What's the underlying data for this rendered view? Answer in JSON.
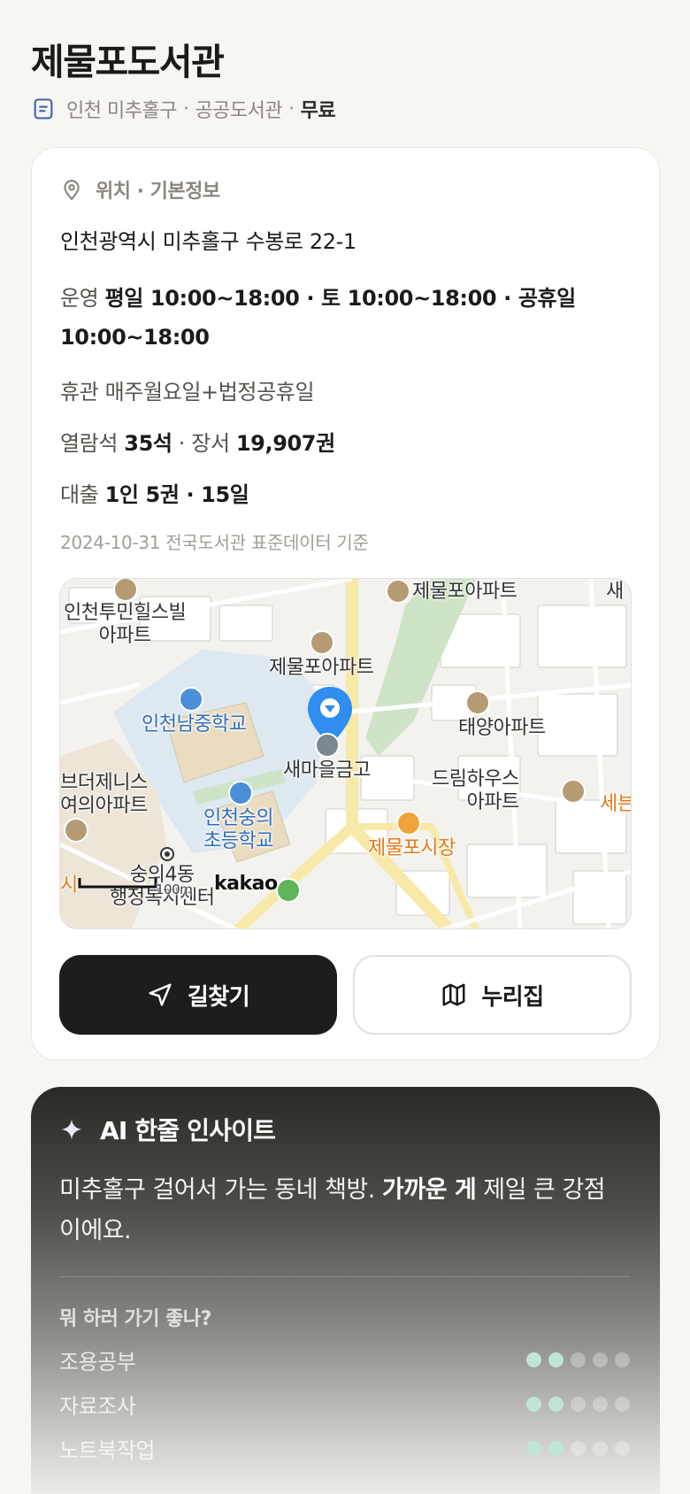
{
  "header": {
    "title": "제물포도서관",
    "region": "인천 미추홀구",
    "category": "공공도서관",
    "fee": "무료",
    "separator": "·"
  },
  "info": {
    "section_title": "위치 · 기본정보",
    "address": "인천광역시 미추홀구 수봉로 22-1",
    "hours_label": "운영",
    "hours_value": "평일 10:00~18:00 · 토 10:00~18:00 · 공휴일 10:00~18:00",
    "closed_label": "휴관",
    "closed_value": "매주월요일+법정공휴일",
    "seats_label": "열람석",
    "seats_value": "35석",
    "books_label": "장서",
    "books_value": "19,907권",
    "loan_label": "대출",
    "loan_value": "1인 5권 · 15일",
    "source_note": "2024-10-31 전국도서관 표준데이터 기준"
  },
  "map": {
    "labels": {
      "apt1": "인천투민힐스빌\n아파트",
      "apt2": "제물포아파트",
      "apt3": "제물포아파트",
      "school1": "인천남중학교",
      "bank": "새마을금고",
      "apt4": "태양아파트",
      "apt5": "드림하우스\n아파트",
      "school2": "인천숭의\n초등학교",
      "market": "제물포시장",
      "apt6": "브더제니스\n여의아파트",
      "office": "숭의4동\n행정복지센터",
      "edge1": "새",
      "edge2": "세븐",
      "edge3": "시"
    },
    "scale": "100m",
    "provider": "kakao",
    "colors": {
      "pin": "#2f8ef0",
      "road": "#f7e9a8",
      "park": "#cfe3c6",
      "school": "#e9dcc0"
    }
  },
  "actions": {
    "directions": "길찾기",
    "website": "누리집"
  },
  "ai": {
    "title": "AI 한줄 인사이트",
    "insight_plain1": "미추홀구 걸어서 가는 동네 책방. ",
    "insight_bold": "가까운 게",
    "insight_plain2": " 제일 큰 강점이에요.",
    "question": "뭐 하러 가기 좋나?",
    "uses": [
      {
        "name": "조용공부",
        "rating": 2,
        "max": 5
      },
      {
        "name": "자료조사",
        "rating": 2,
        "max": 5
      },
      {
        "name": "노트북작업",
        "rating": 2,
        "max": 5
      }
    ]
  }
}
